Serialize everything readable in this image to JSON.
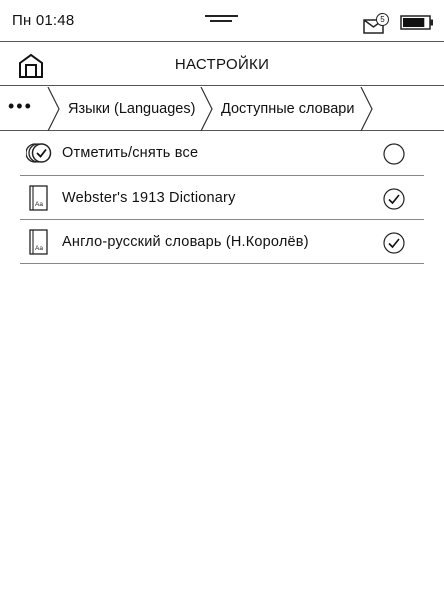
{
  "status": {
    "time": "Пн 01:48",
    "mail_count": "5",
    "battery_level": 0.85
  },
  "header": {
    "title": "НАСТРОЙКИ",
    "home_icon": "home-icon"
  },
  "breadcrumb": {
    "more_label": "•••",
    "items": [
      {
        "label": "Языки (Languages)"
      },
      {
        "label": "Доступные словари"
      }
    ]
  },
  "list": {
    "items": [
      {
        "label": "Отметить/снять все",
        "icon": "select-all-icon",
        "checked": false
      },
      {
        "label": "Webster's 1913 Dictionary",
        "icon": "dictionary-book-icon",
        "checked": true
      },
      {
        "label": "Англо-русский словарь (Н.Королёв)",
        "icon": "dictionary-book-icon",
        "checked": true
      }
    ]
  },
  "colors": {
    "foreground": "#111111",
    "divider": "#555555",
    "background": "#ffffff"
  }
}
